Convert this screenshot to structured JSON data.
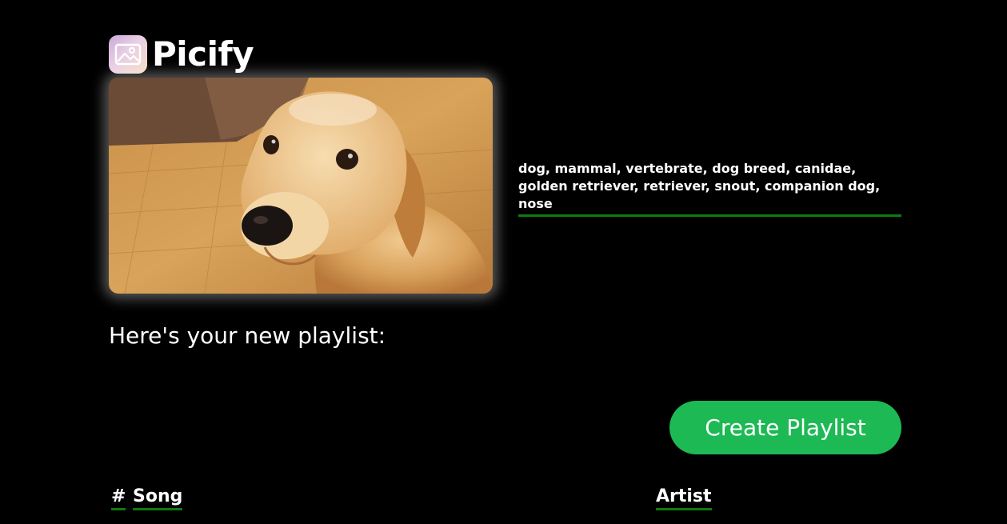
{
  "app": {
    "title": "Picify",
    "logo_icon": "image-icon"
  },
  "photo": {
    "subject": "golden retriever dog"
  },
  "tags": {
    "text": "dog, mammal, vertebrate, dog breed, canidae, golden retriever, retriever, snout, companion dog, nose"
  },
  "playlist": {
    "heading": "Here's your new playlist:",
    "create_button_label": "Create Playlist",
    "columns": {
      "number": "#",
      "song": "Song",
      "artist": "Artist"
    }
  },
  "colors": {
    "background": "#000000",
    "accent_green": "#1db954",
    "underline_green": "#0f7a0f"
  }
}
